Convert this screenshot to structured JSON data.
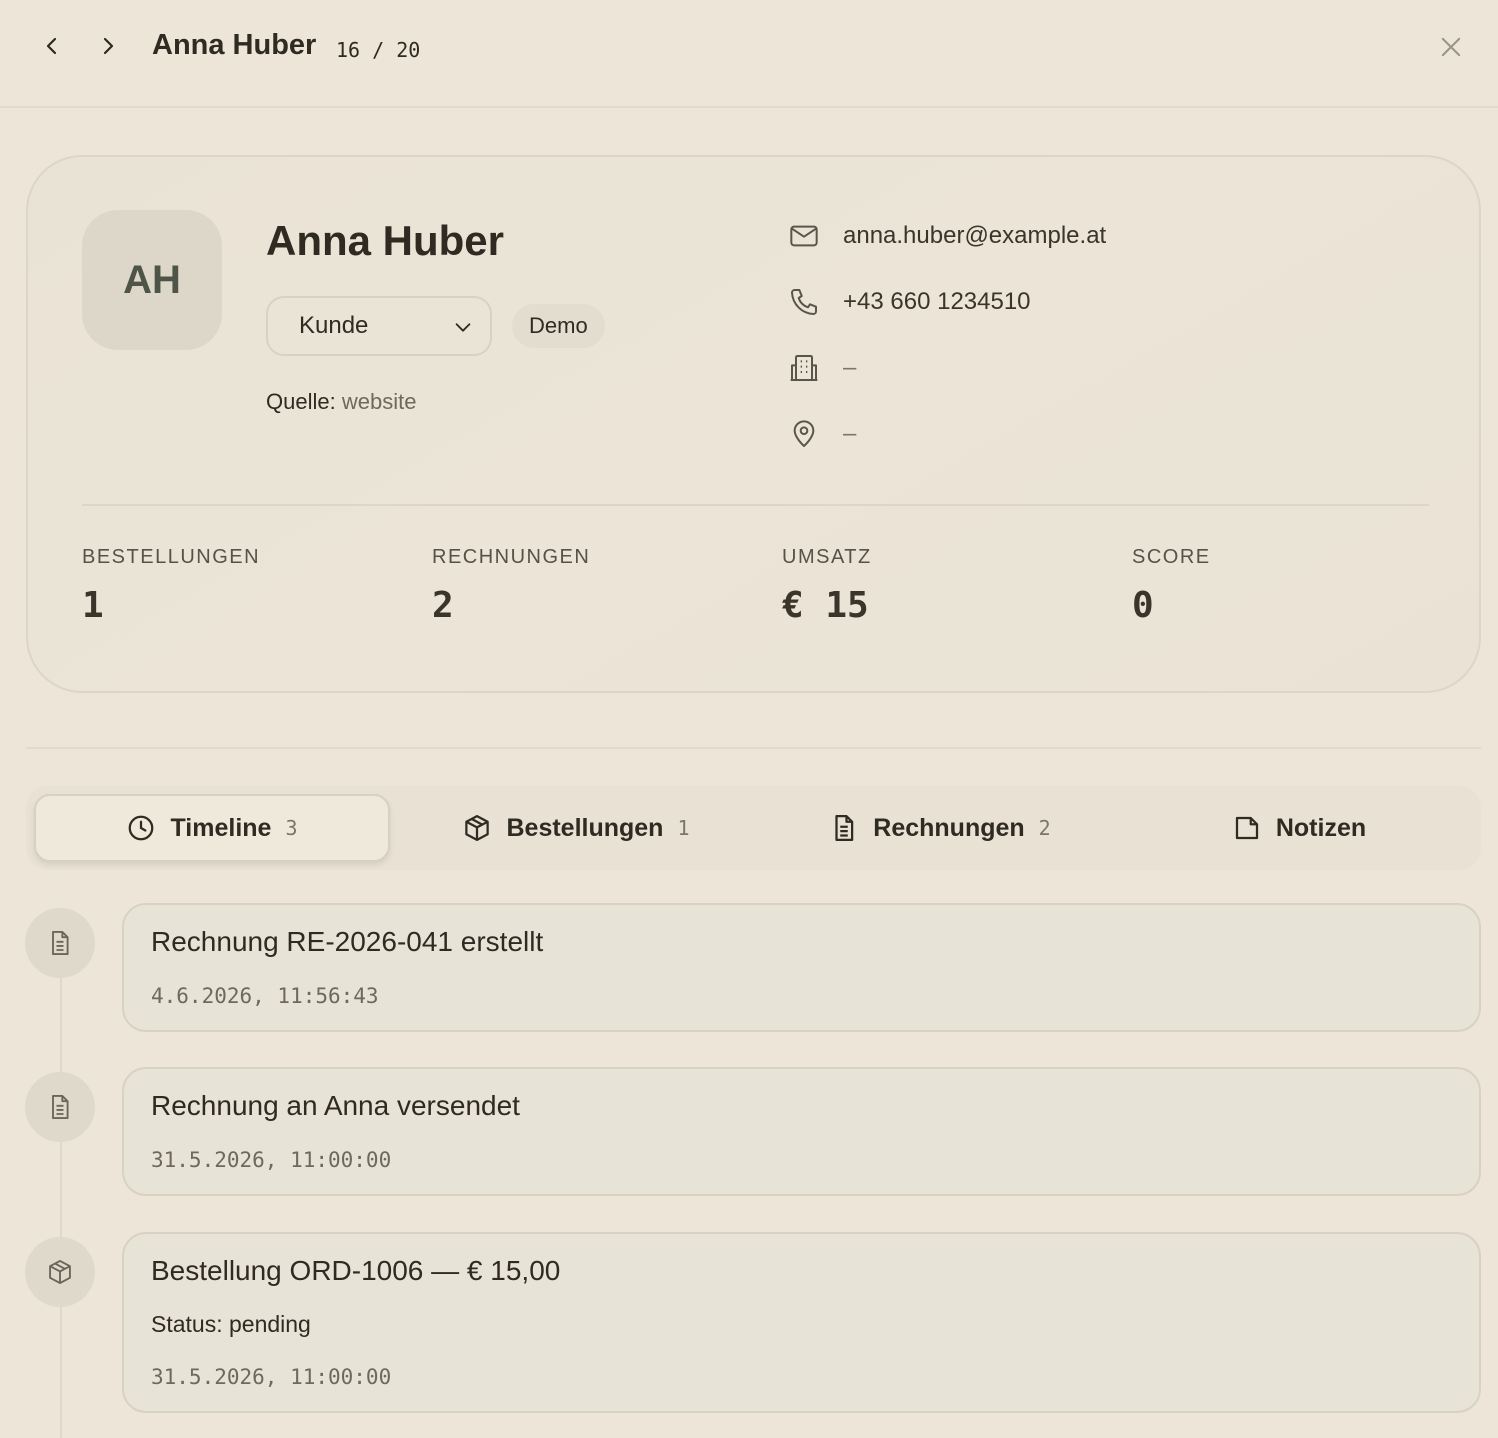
{
  "header": {
    "title": "Anna Huber",
    "counter": "16 / 20",
    "prev_icon": "chevron-left-icon",
    "next_icon": "chevron-right-icon",
    "close_icon": "close-icon"
  },
  "profile": {
    "initials": "AH",
    "name": "Anna Huber",
    "status_value": "Kunde",
    "badge": "Demo",
    "source_label": "Quelle:",
    "source_value": "website",
    "email": "anna.huber@example.at",
    "phone": "+43 660 1234510",
    "company": "–",
    "address": "–"
  },
  "stats": [
    {
      "label": "BESTELLUNGEN",
      "value": "1"
    },
    {
      "label": "RECHNUNGEN",
      "value": "2"
    },
    {
      "label": "UMSATZ",
      "value": "€ 15"
    },
    {
      "label": "SCORE",
      "value": "0"
    }
  ],
  "tabs": [
    {
      "label": "Timeline",
      "count": "3",
      "icon": "clock-icon"
    },
    {
      "label": "Bestellungen",
      "count": "1",
      "icon": "package-icon"
    },
    {
      "label": "Rechnungen",
      "count": "2",
      "icon": "document-icon"
    },
    {
      "label": "Notizen",
      "count": "",
      "icon": "note-icon"
    }
  ],
  "timeline": [
    {
      "title": "Rechnung RE-2026-041 erstellt",
      "time": "4.6.2026, 11:56:43",
      "icon": "document-icon"
    },
    {
      "title": "Rechnung an Anna versendet",
      "time": "31.5.2026, 11:00:00",
      "icon": "document-icon"
    },
    {
      "title": "Bestellung ORD-1006 — € 15,00",
      "status": "Status: pending",
      "time": "31.5.2026, 11:00:00",
      "icon": "package-icon"
    }
  ],
  "colors": {
    "background": "#ede6d8",
    "text": "#2f2a22",
    "muted": "#7b766a",
    "avatar_bg": "#dcd7c8"
  }
}
